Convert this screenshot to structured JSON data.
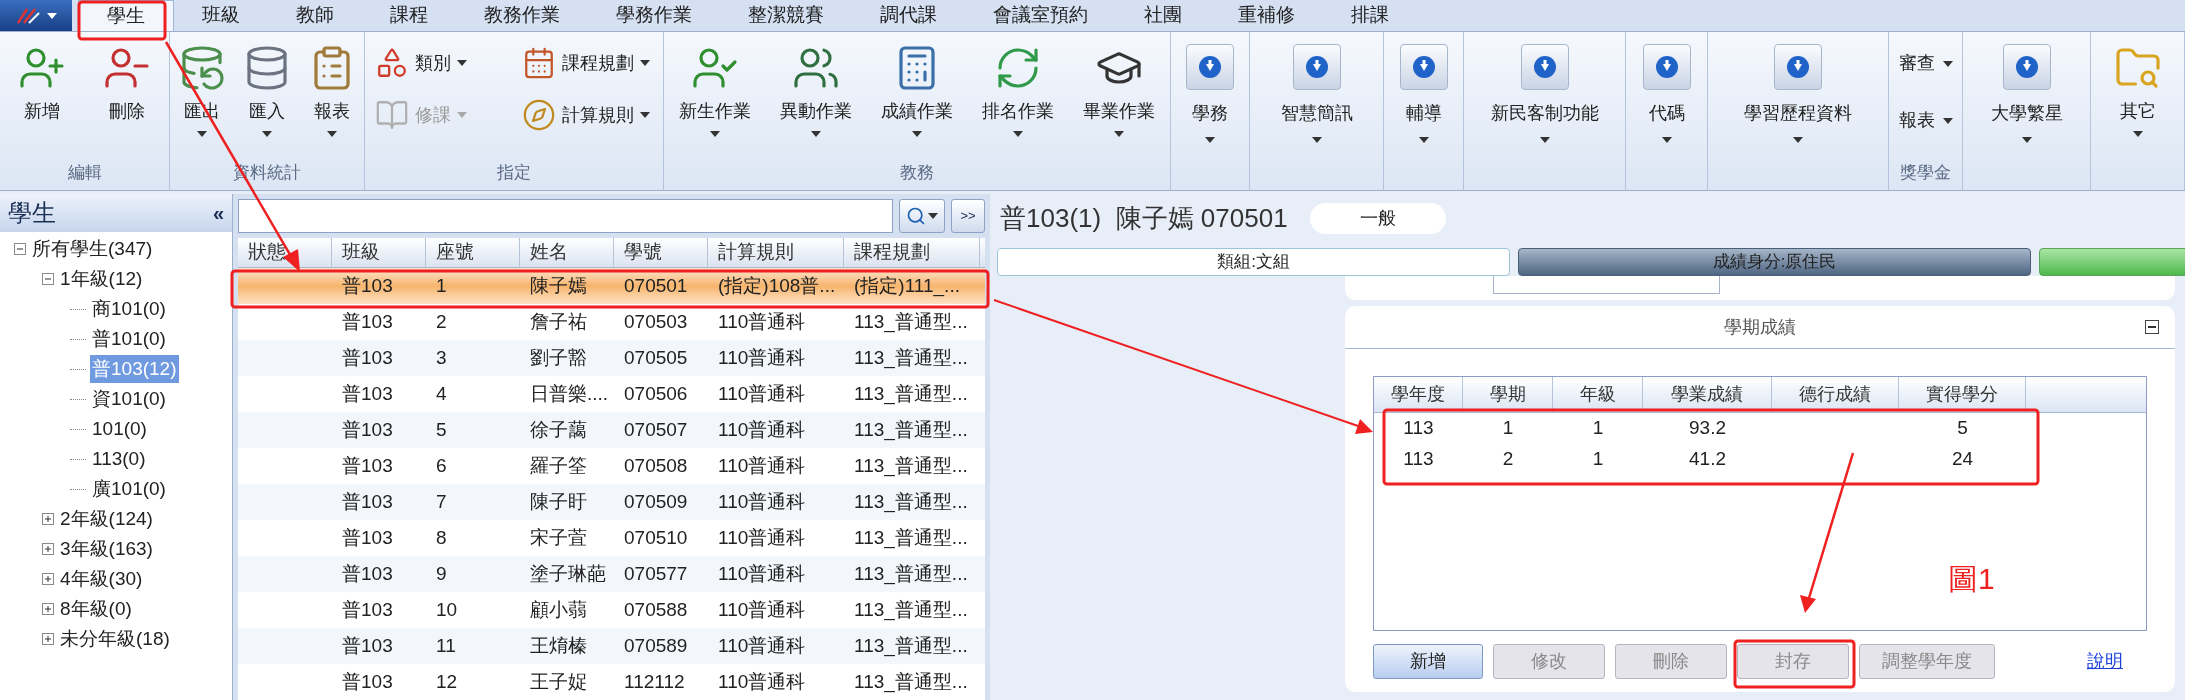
{
  "ribbon": {
    "tabs": [
      {
        "label": "學生",
        "selected": true
      },
      {
        "label": "班級",
        "selected": false
      },
      {
        "label": "教師",
        "selected": false
      },
      {
        "label": "課程",
        "selected": false
      },
      {
        "label": "教務作業",
        "selected": false
      },
      {
        "label": "學務作業",
        "selected": false
      },
      {
        "label": "整潔競賽",
        "selected": false
      },
      {
        "label": "調代課",
        "selected": false
      },
      {
        "label": "會議室預約",
        "selected": false
      },
      {
        "label": "社團",
        "selected": false
      },
      {
        "label": "重補修",
        "selected": false
      },
      {
        "label": "排課",
        "selected": false
      }
    ],
    "groups": [
      {
        "label": "編輯",
        "items": [
          {
            "kind": "large",
            "label": "新增",
            "caret": false
          },
          {
            "kind": "large",
            "label": "刪除",
            "caret": false
          }
        ]
      },
      {
        "label": "資料統計",
        "items": [
          {
            "kind": "large",
            "label": "匯出",
            "caret": true
          },
          {
            "kind": "large",
            "label": "匯入",
            "caret": true
          },
          {
            "kind": "large",
            "label": "報表",
            "caret": true
          }
        ]
      },
      {
        "label": "指定",
        "items": [
          {
            "kind": "small",
            "label": "類別",
            "caret": true,
            "disabled": false
          },
          {
            "kind": "small",
            "label": "課程規劃",
            "caret": true,
            "disabled": false
          },
          {
            "kind": "small",
            "label": "修課",
            "caret": true,
            "disabled": true
          },
          {
            "kind": "small",
            "label": "計算規則",
            "caret": true,
            "disabled": false
          }
        ]
      },
      {
        "label": "教務",
        "items": [
          {
            "kind": "large",
            "label": "新生作業",
            "caret": true
          },
          {
            "kind": "large",
            "label": "異動作業",
            "caret": true
          },
          {
            "kind": "large",
            "label": "成績作業",
            "caret": true
          },
          {
            "kind": "large",
            "label": "排名作業",
            "caret": true
          },
          {
            "kind": "large",
            "label": "畢業作業",
            "caret": true
          }
        ]
      },
      {
        "items": [
          {
            "kind": "drop",
            "label": "學務",
            "caret": true
          }
        ]
      },
      {
        "items": [
          {
            "kind": "drop",
            "label": "智慧簡訊",
            "caret": true
          }
        ]
      },
      {
        "items": [
          {
            "kind": "drop",
            "label": "輔導",
            "caret": true
          }
        ]
      },
      {
        "items": [
          {
            "kind": "drop",
            "label": "新民客制功能",
            "caret": true
          }
        ]
      },
      {
        "items": [
          {
            "kind": "drop",
            "label": "代碼",
            "caret": true
          }
        ]
      },
      {
        "items": [
          {
            "kind": "drop",
            "label": "學習歷程資料",
            "caret": true
          }
        ]
      },
      {
        "label": "獎學金",
        "items": [
          {
            "kind": "menu",
            "label": "審查",
            "caret": true
          },
          {
            "kind": "menu",
            "label": "報表",
            "caret": true
          }
        ]
      },
      {
        "items": [
          {
            "kind": "drop",
            "label": "大學繁星",
            "caret": true
          }
        ]
      },
      {
        "items": [
          {
            "kind": "large",
            "label": "其它",
            "caret": true
          }
        ]
      }
    ]
  },
  "sidebar": {
    "title": "學生",
    "collapse": "«",
    "tree": [
      {
        "label": "所有學生(347)",
        "expanded": true,
        "selected": false,
        "children": [
          {
            "label": "1年級(12)",
            "expanded": true,
            "selected": false,
            "children": [
              {
                "label": "商101(0)",
                "selected": false
              },
              {
                "label": "普101(0)",
                "selected": false
              },
              {
                "label": "普103(12)",
                "selected": true
              },
              {
                "label": "資101(0)",
                "selected": false
              },
              {
                "label": "101(0)",
                "selected": false
              },
              {
                "label": "113(0)",
                "selected": false
              },
              {
                "label": "廣101(0)",
                "selected": false
              }
            ]
          },
          {
            "label": "2年級(124)",
            "expanded": false,
            "selected": false
          },
          {
            "label": "3年級(163)",
            "expanded": false,
            "selected": false
          },
          {
            "label": "4年級(30)",
            "expanded": false,
            "selected": false
          },
          {
            "label": "8年級(0)",
            "expanded": false,
            "selected": false
          },
          {
            "label": "未分年級(18)",
            "expanded": false,
            "selected": false
          }
        ]
      }
    ]
  },
  "student_list": {
    "more_button": ">>",
    "columns": [
      "狀態",
      "班級",
      "座號",
      "姓名",
      "學號",
      "計算規則",
      "課程規劃"
    ],
    "rows": [
      {
        "selected": true,
        "class": "普103",
        "seat": "1",
        "name": "陳子嫣",
        "id": "070501",
        "calc_rule": "(指定)108普...",
        "course_plan": "(指定)111_..."
      },
      {
        "selected": false,
        "class": "普103",
        "seat": "2",
        "name": "詹子祐",
        "id": "070503",
        "calc_rule": "110普通科",
        "course_plan": "113_普通型..."
      },
      {
        "selected": false,
        "class": "普103",
        "seat": "3",
        "name": "劉子豁",
        "id": "070505",
        "calc_rule": "110普通科",
        "course_plan": "113_普通型..."
      },
      {
        "selected": false,
        "class": "普103",
        "seat": "4",
        "name": "日普樂....",
        "id": "070506",
        "calc_rule": "110普通科",
        "course_plan": "113_普通型..."
      },
      {
        "selected": false,
        "class": "普103",
        "seat": "5",
        "name": "徐子藹",
        "id": "070507",
        "calc_rule": "110普通科",
        "course_plan": "113_普通型..."
      },
      {
        "selected": false,
        "class": "普103",
        "seat": "6",
        "name": "羅子筌",
        "id": "070508",
        "calc_rule": "110普通科",
        "course_plan": "113_普通型..."
      },
      {
        "selected": false,
        "class": "普103",
        "seat": "7",
        "name": "陳子盱",
        "id": "070509",
        "calc_rule": "110普通科",
        "course_plan": "113_普通型..."
      },
      {
        "selected": false,
        "class": "普103",
        "seat": "8",
        "name": "宋子萓",
        "id": "070510",
        "calc_rule": "110普通科",
        "course_plan": "113_普通型..."
      },
      {
        "selected": false,
        "class": "普103",
        "seat": "9",
        "name": "塗子琳葩",
        "id": "070577",
        "calc_rule": "110普通科",
        "course_plan": "113_普通型..."
      },
      {
        "selected": false,
        "class": "普103",
        "seat": "10",
        "name": "顧小蒻",
        "id": "070588",
        "calc_rule": "110普通科",
        "course_plan": "113_普通型..."
      },
      {
        "selected": false,
        "class": "普103",
        "seat": "11",
        "name": "王焴榛",
        "id": "070589",
        "calc_rule": "110普通科",
        "course_plan": "113_普通型..."
      },
      {
        "selected": false,
        "class": "普103",
        "seat": "12",
        "name": "王子娖",
        "id": "112112",
        "calc_rule": "110普通科",
        "course_plan": "113_普通型..."
      }
    ]
  },
  "detail": {
    "heading": "普103(1)  陳子嫣 070501",
    "status": "一般",
    "tags": [
      {
        "kind": "plain",
        "label": "類組:文組"
      },
      {
        "kind": "dark",
        "label": "成績身分:原住民"
      },
      {
        "kind": "green"
      }
    ],
    "card": {
      "title": "學期成績",
      "columns": [
        "學年度",
        "學期",
        "年級",
        "學業成績",
        "德行成績",
        "實得學分"
      ],
      "rows": [
        {
          "year": "113",
          "term": "1",
          "grade": "1",
          "academic": "93.2",
          "credits": "5"
        },
        {
          "year": "113",
          "term": "2",
          "grade": "1",
          "academic": "41.2",
          "credits": "24"
        }
      ],
      "buttons": [
        {
          "label": "新增",
          "disabled": false
        },
        {
          "label": "修改",
          "disabled": true
        },
        {
          "label": "刪除",
          "disabled": true
        },
        {
          "label": "封存",
          "disabled": true
        },
        {
          "label": "調整學年度",
          "disabled": true
        }
      ],
      "help_link": "說明"
    }
  },
  "annotation": {
    "figure_label": "圖1"
  }
}
